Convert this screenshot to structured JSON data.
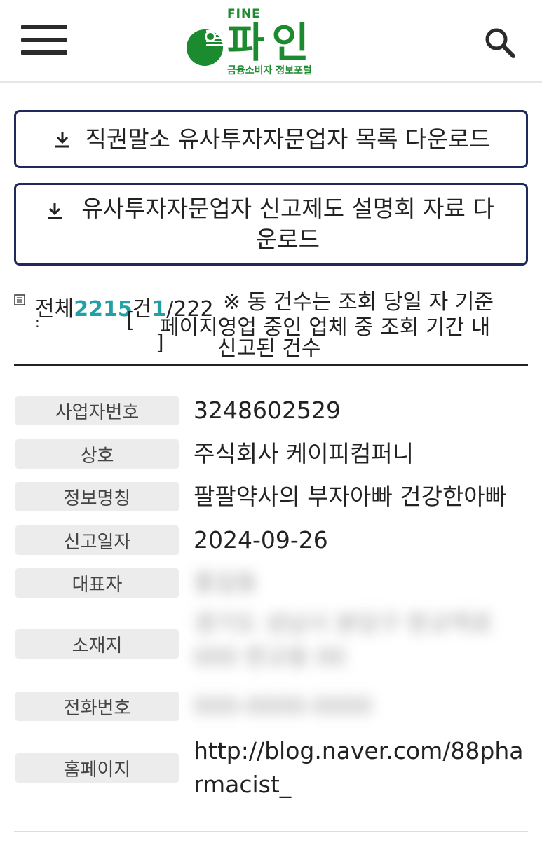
{
  "header": {
    "logo_fine": "FINE",
    "logo_main": "파인",
    "logo_sub": "금융소비자 정보포털"
  },
  "buttons": {
    "download_list": "직권말소 유사투자자문업자 목록 다운로드",
    "download_seminar": "유사투자자문업자 신고제도 설명회 자료 다운로드"
  },
  "summary": {
    "total_label": "전체",
    "total_count": "2215",
    "total_unit": "건",
    "page_current": "1",
    "page_total": "/222",
    "note_line1": "※ 동 건수는 조회 당일 자 기준",
    "note_line2": "페이지영업 중인 업체 중 조회 기간 내",
    "note_line3": "신고된 건수"
  },
  "details": [
    {
      "label": "사업자번호",
      "value": "3248602529"
    },
    {
      "label": "상호",
      "value": "주식회사 케이피컴퍼니"
    },
    {
      "label": "정보명칭",
      "value": "팔팔약사의 부자아빠 건강한아빠"
    },
    {
      "label": "신고일자",
      "value": "2024-09-26"
    },
    {
      "label": "대표자",
      "value": "홍길동"
    },
    {
      "label": "소재지",
      "value": "경기도 성남시 분당구 판교역로 000 판교동 00"
    },
    {
      "label": "전화번호",
      "value": "000-0000-0000"
    },
    {
      "label": "홈페이지",
      "value": "http://blog.naver.com/88pharmacist_"
    }
  ],
  "icons": {
    "menu": "hamburger-menu-icon",
    "search": "search-icon",
    "download": "download-icon",
    "document": "document-icon"
  },
  "colors": {
    "brand_green": "#1c8a2e",
    "count_teal": "#23a0a6",
    "button_border": "#1f2a5a"
  }
}
